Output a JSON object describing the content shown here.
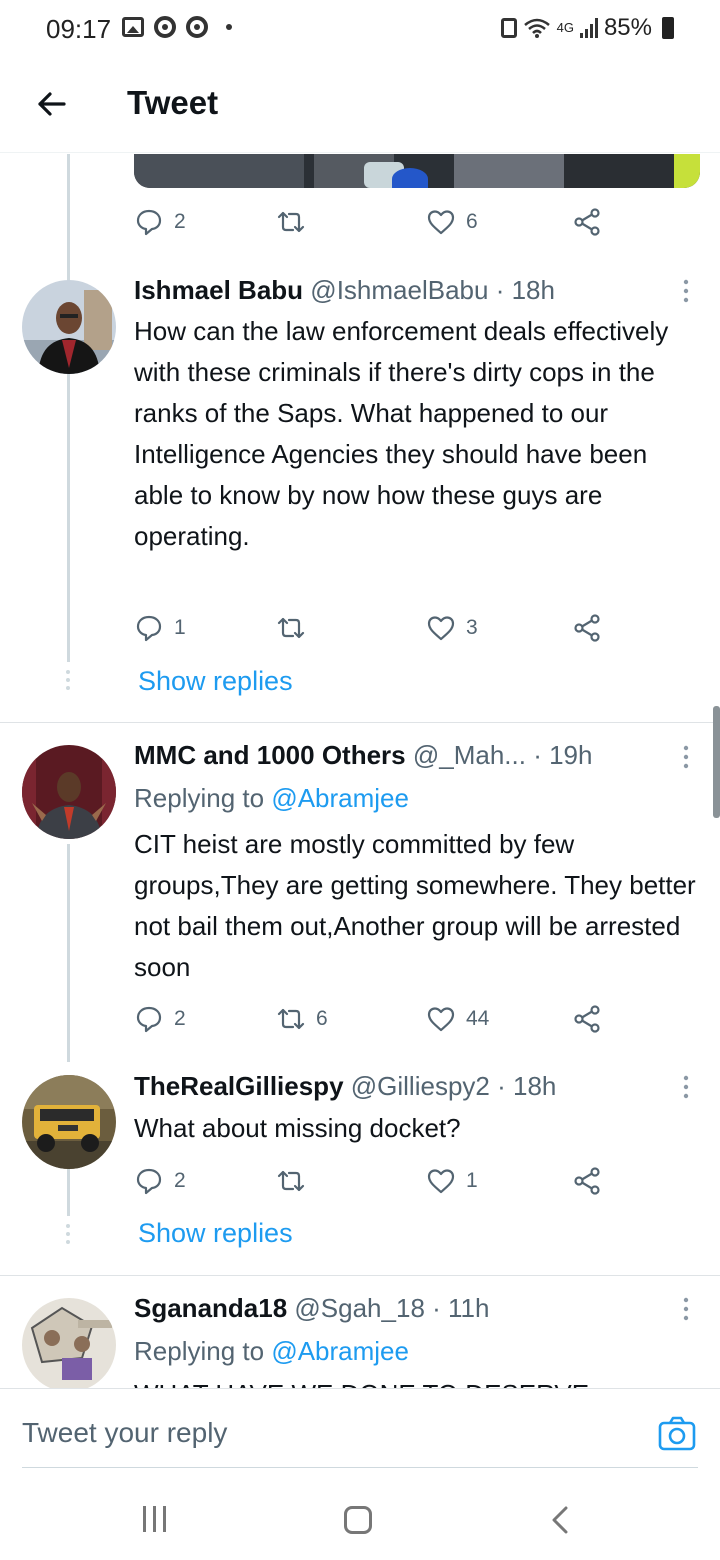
{
  "status_bar": {
    "time": "09:17",
    "network": "4G",
    "battery": "85%"
  },
  "header": {
    "title": "Tweet"
  },
  "prev_actions": {
    "replies": "2",
    "retweets": "",
    "likes": "6"
  },
  "tweets": [
    {
      "name": "Ishmael Babu",
      "handle": "@IshmaelBabu",
      "time": "· 18h",
      "text": "How can the law enforcement deals effectively with these criminals if there's dirty cops in the ranks of the Saps. What happened to our Intelligence Agencies they should have been able to know by now how these guys are operating.",
      "replies": "1",
      "retweets": "",
      "likes": "3",
      "show_replies": "Show replies"
    },
    {
      "name": "MMC and 1000 Others",
      "handle": "@_Mah...",
      "time": "· 19h",
      "replying_label": "Replying to",
      "replying_to": "@Abramjee",
      "text": "CIT heist are mostly committed by few groups,They are getting somewhere. They better not bail them out,Another group will be arrested soon",
      "replies": "2",
      "retweets": "6",
      "likes": "44"
    },
    {
      "name": "TheRealGilliespy",
      "handle": "@Gilliespy2",
      "time": "· 18h",
      "text": "What about missing docket?",
      "replies": "2",
      "retweets": "",
      "likes": "1",
      "show_replies": "Show replies"
    },
    {
      "name": "Sgananda18",
      "handle": "@Sgah_18",
      "time": "· 11h",
      "replying_label": "Replying to",
      "replying_to": "@Abramjee",
      "text": "WHAT HAVE WE DONE TO DESERVE"
    }
  ],
  "reply_bar": {
    "placeholder": "Tweet your reply"
  },
  "colors": {
    "accent": "#1d9bf0",
    "secondary_text": "#536471",
    "primary_text": "#0f1419"
  },
  "icons": [
    "back-arrow-icon",
    "reply-icon",
    "retweet-icon",
    "like-icon",
    "share-icon",
    "more-icon",
    "camera-icon"
  ]
}
